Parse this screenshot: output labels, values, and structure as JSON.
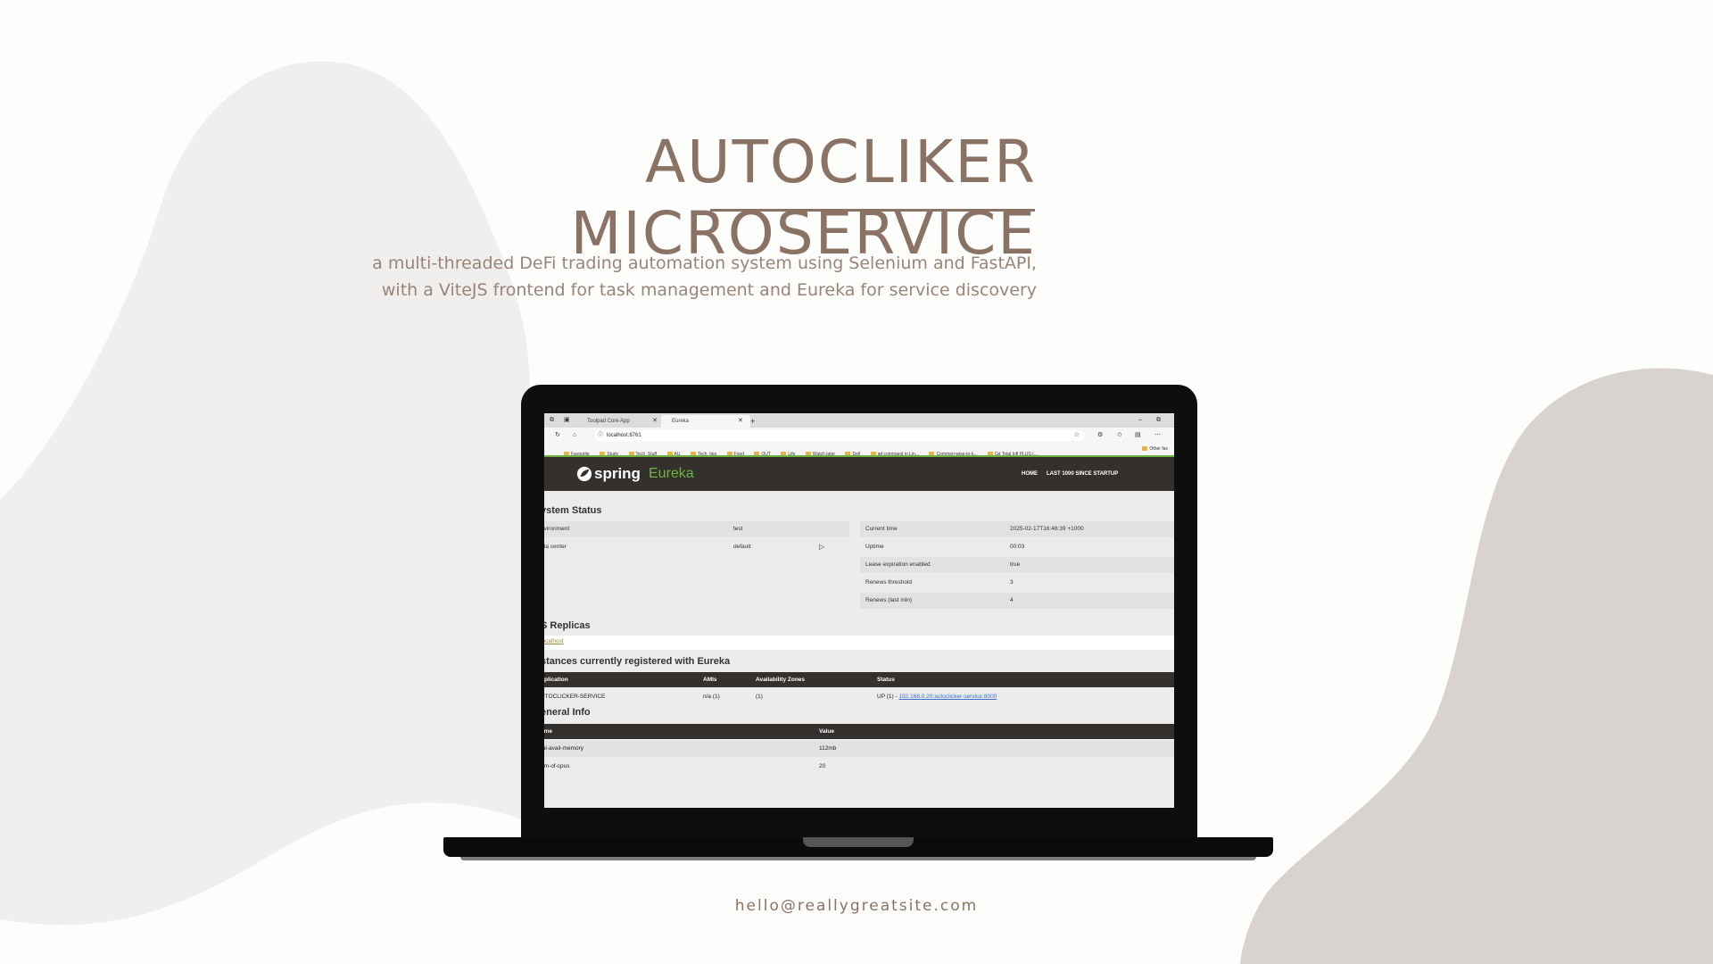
{
  "slide": {
    "title": "AUTOCLIKER MICROSERVICE",
    "subtitle_line1": "a multi-threaded DeFi trading automation system using Selenium and FastAPI,",
    "subtitle_line2": "with a ViteJS frontend for task management and Eureka for service discovery",
    "email": "hello@reallygreatsite.com",
    "colors": {
      "accent": "#8a7264",
      "blob_light": "#f0efed",
      "blob_dark": "#d9d3cf"
    }
  },
  "browser": {
    "tabs": [
      {
        "label": "Toolpad Core App"
      },
      {
        "label": "Eureka"
      }
    ],
    "new_tab": "+",
    "url": "localhost:8761",
    "bookmarks": [
      "Favourite",
      "Study",
      "Tech_Stuff",
      "AU",
      "Tech_tips",
      "Food",
      "OUT",
      "Life",
      "Watch later",
      "Dell",
      "ad command in Lin...",
      "Common-wise-to-k...",
      "Git Total Infl PLUS (..."
    ],
    "bookmark_overflow": "Other fav"
  },
  "eureka": {
    "logo_spring": "spring",
    "logo_eureka": "Eureka",
    "nav_home": "HOME",
    "nav_last": "LAST 1000 SINCE STARTUP",
    "system_status_title": "ystem Status",
    "left_rows": [
      {
        "label": "nvironment",
        "value": "test"
      },
      {
        "label": "ata center",
        "value": "default"
      }
    ],
    "right_rows": [
      {
        "label": "Current time",
        "value": "2025-02-17T16:48:39 +1000"
      },
      {
        "label": "Uptime",
        "value": "00:03"
      },
      {
        "label": "Lease expiration enabled",
        "value": "true"
      },
      {
        "label": "Renews threshold",
        "value": "3"
      },
      {
        "label": "Renews (last min)",
        "value": "4"
      }
    ],
    "replicas_title": "S Replicas",
    "replica_link": "localhost",
    "instances_title": "stances currently registered with Eureka",
    "instances_headers": [
      "pplication",
      "AMIs",
      "Availability Zones",
      "Status"
    ],
    "instances_row": {
      "app": "UTOCLICKER-SERVICE",
      "amis": "n/a (1)",
      "zones": "(1)",
      "status_prefix": "UP (1) - ",
      "status_link": "192.168.0.20:autoclicker-service:8000"
    },
    "general_title": "eneral Info",
    "general_headers": [
      "ame",
      "Value"
    ],
    "general_rows": [
      {
        "name": "tal-avail-memory",
        "value": "112mb"
      },
      {
        "name": "um-of-cpus",
        "value": "20"
      }
    ]
  }
}
